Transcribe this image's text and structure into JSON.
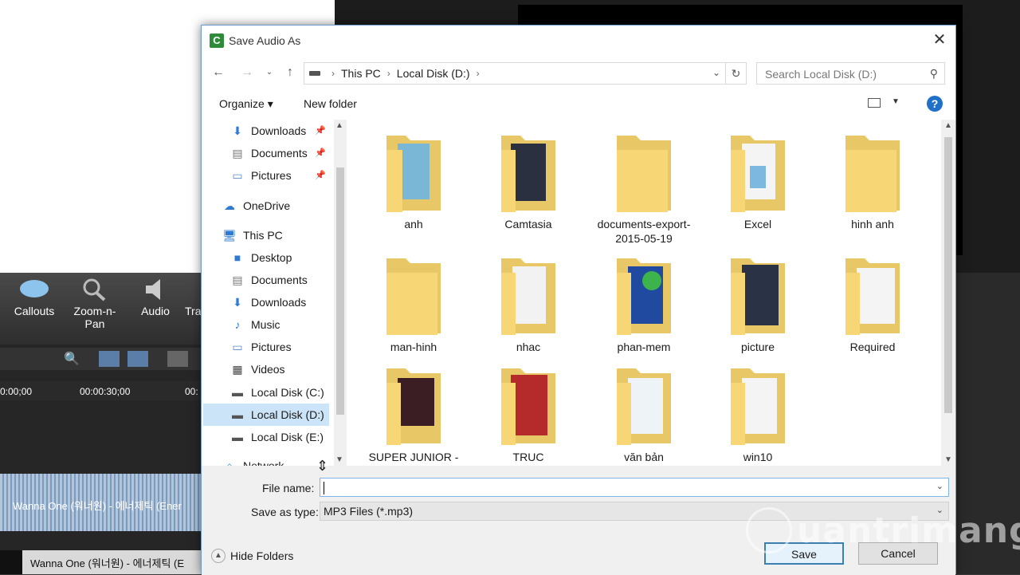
{
  "background_app": {
    "tools": [
      "Callouts",
      "Zoom-n-Pan",
      "Audio",
      "Tra"
    ],
    "ruler": [
      "0:00;00",
      "00:00:30;00",
      "00:",
      "00"
    ],
    "track1_label": "Wanna One (워너원) - 에너제틱 (Ener",
    "track2_label": "Wanna One (워너원) - 에너제틱 (E"
  },
  "dialog": {
    "title": "Save Audio As",
    "app_icon": "C",
    "close": "✕",
    "breadcrumb": [
      "This PC",
      "Local Disk (D:)"
    ],
    "search_placeholder": "Search Local Disk (D:)",
    "organize": "Organize ▾",
    "new_folder": "New folder",
    "help": "?",
    "nav_items": [
      {
        "label": "Downloads",
        "icon": "download-icon"
      },
      {
        "label": "Documents",
        "icon": "document-icon"
      },
      {
        "label": "Pictures",
        "icon": "pictures-icon"
      },
      {
        "label": "OneDrive",
        "icon": "cloud-icon"
      },
      {
        "label": "This PC",
        "icon": "computer-icon"
      },
      {
        "label": "Desktop",
        "icon": "desktop-icon"
      },
      {
        "label": "Documents",
        "icon": "document-icon"
      },
      {
        "label": "Downloads",
        "icon": "download-icon"
      },
      {
        "label": "Music",
        "icon": "music-icon"
      },
      {
        "label": "Pictures",
        "icon": "pictures-icon"
      },
      {
        "label": "Videos",
        "icon": "videos-icon"
      },
      {
        "label": "Local Disk (C:)",
        "icon": "drive-icon"
      },
      {
        "label": "Local Disk (D:)",
        "icon": "drive-icon",
        "selected": true
      },
      {
        "label": "Local Disk (E:)",
        "icon": "drive-icon"
      },
      {
        "label": "Network",
        "icon": "network-icon"
      }
    ],
    "folders": [
      {
        "name": "anh"
      },
      {
        "name": "Camtasia"
      },
      {
        "name": "documents-export-2015-05-19"
      },
      {
        "name": "Excel"
      },
      {
        "name": "hinh anh"
      },
      {
        "name": "man-hinh"
      },
      {
        "name": "nhac"
      },
      {
        "name": "phan-mem"
      },
      {
        "name": "picture"
      },
      {
        "name": "Required"
      },
      {
        "name": "SUPER JUNIOR -"
      },
      {
        "name": "TRUC"
      },
      {
        "name": "văn bản"
      },
      {
        "name": "win10"
      }
    ],
    "file_name_label": "File name:",
    "file_name_value": "",
    "save_type_label": "Save as type:",
    "save_type_value": "MP3 Files (*.mp3)",
    "hide_folders": "Hide Folders",
    "save": "Save",
    "cancel": "Cancel"
  },
  "watermark": "uantrimang"
}
